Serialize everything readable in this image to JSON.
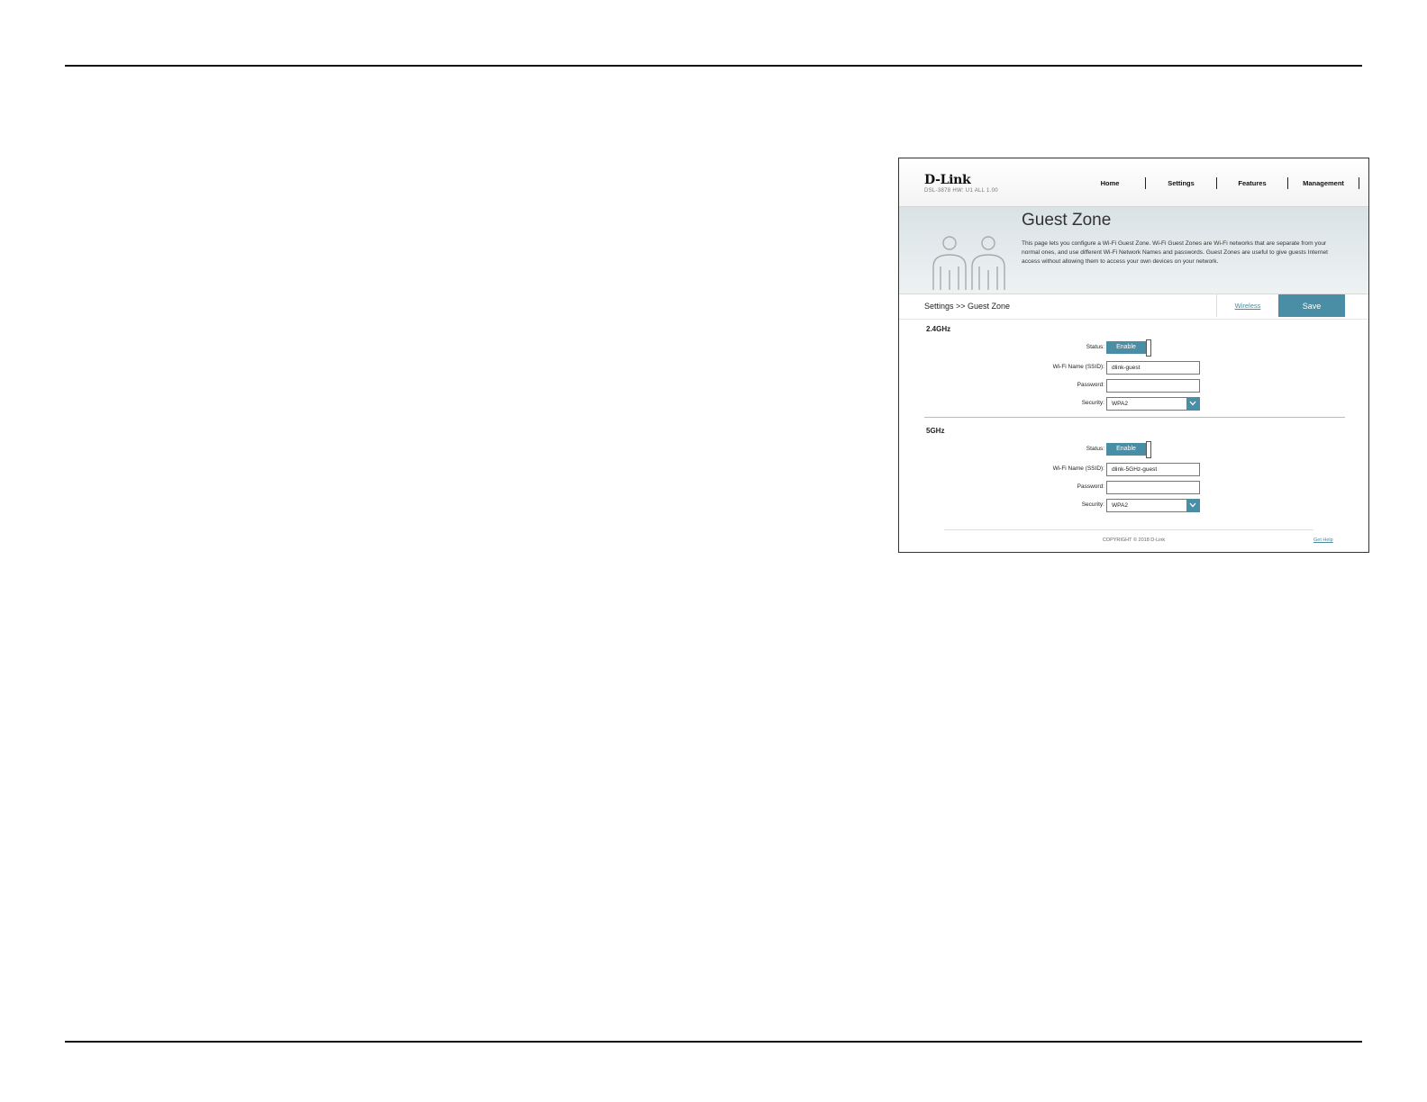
{
  "app": {
    "logo": "D-Link",
    "model": "DSL-3878 HW: U1 ALL 1.00"
  },
  "nav": {
    "items": [
      {
        "label": "Home"
      },
      {
        "label": "Settings"
      },
      {
        "label": "Features"
      },
      {
        "label": "Management"
      }
    ]
  },
  "banner": {
    "title": "Guest Zone",
    "description": "This page lets you configure a Wi-Fi Guest Zone. Wi-Fi Guest Zones are Wi-Fi networks that are separate from your normal ones, and use different Wi-Fi Network Names and passwords. Guest Zones are useful to give guests Internet access without allowing them to access your own devices on your network."
  },
  "breadcrumb": "Settings >> Guest Zone",
  "toolbar": {
    "wireless_link": "Wireless",
    "save_label": "Save"
  },
  "bands": [
    {
      "title": "2.4GHz",
      "status_label": "Status:",
      "status_value": "Enable",
      "ssid_label": "Wi-Fi Name (SSID):",
      "ssid_value": "dlink-guest",
      "password_label": "Password:",
      "password_value": "",
      "security_label": "Security:",
      "security_value": "WPA2"
    },
    {
      "title": "5GHz",
      "status_label": "Status:",
      "status_value": "Enable",
      "ssid_label": "Wi-Fi Name (SSID):",
      "ssid_value": "dlink-5GHz-guest",
      "password_label": "Password:",
      "password_value": "",
      "security_label": "Security:",
      "security_value": "WPA2"
    }
  ],
  "footer": {
    "copyright": "COPYRIGHT © 2018 D-Link",
    "help_link": "Get Help"
  },
  "colors": {
    "accent": "#4a8ea6",
    "banner_bg": "#e3e9eb"
  },
  "icons": {
    "banner_icon": "guests-icon",
    "select_arrow": "chevron-down-icon"
  }
}
